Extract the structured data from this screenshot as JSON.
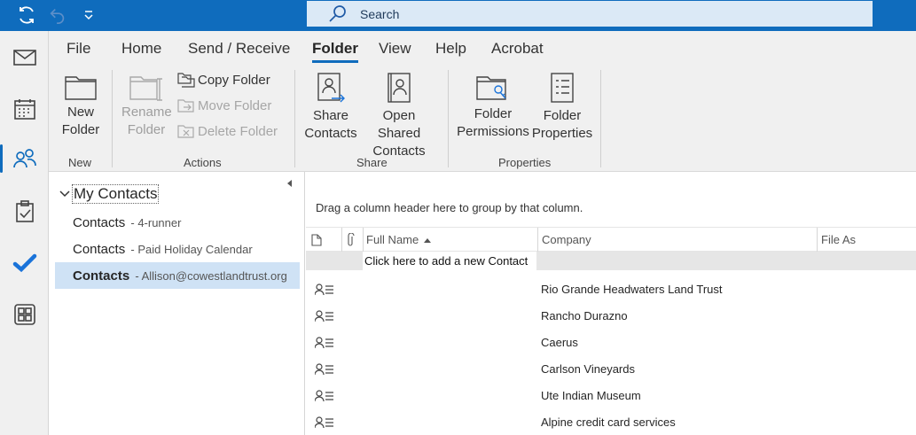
{
  "titlebar": {
    "search_placeholder": "Search",
    "icons": [
      "sync-icon",
      "undo-icon",
      "customize-quick-access-icon",
      "search-icon"
    ]
  },
  "rail": {
    "items": [
      {
        "name": "mail",
        "icon": "mail-icon"
      },
      {
        "name": "calendar",
        "icon": "calendar-icon"
      },
      {
        "name": "people",
        "icon": "people-icon",
        "active": true
      },
      {
        "name": "tasks",
        "icon": "tasks-icon"
      },
      {
        "name": "todo",
        "icon": "todo-check-icon"
      },
      {
        "name": "apps",
        "icon": "apps-icon"
      }
    ]
  },
  "ribbon": {
    "tabs": [
      "File",
      "Home",
      "Send / Receive",
      "Folder",
      "View",
      "Help",
      "Acrobat"
    ],
    "active_tab": "Folder",
    "groups": {
      "new": {
        "label": "New",
        "new_folder": [
          "New",
          "Folder"
        ]
      },
      "actions": {
        "label": "Actions",
        "rename_folder": [
          "Rename",
          "Folder"
        ],
        "copy_folder": "Copy Folder",
        "move_folder": "Move Folder",
        "delete_folder": "Delete Folder"
      },
      "share": {
        "label": "Share",
        "share_contacts": [
          "Share",
          "Contacts"
        ],
        "open_shared_contacts": [
          "Open Shared",
          "Contacts"
        ]
      },
      "properties": {
        "label": "Properties",
        "folder_permissions": [
          "Folder",
          "Permissions"
        ],
        "folder_properties": [
          "Folder",
          "Properties"
        ]
      }
    }
  },
  "folders": {
    "header": "My Contacts",
    "items": [
      {
        "main": "Contacts",
        "sub": "- 4-runner",
        "selected": false
      },
      {
        "main": "Contacts",
        "sub": "- Paid Holiday Calendar",
        "selected": false
      },
      {
        "main": "Contacts",
        "sub": "- Allison@cowestlandtrust.org",
        "selected": true
      }
    ]
  },
  "list": {
    "group_hint": "Drag a column header here to group by that column.",
    "columns": {
      "full_name": "Full Name",
      "company": "Company",
      "file_as": "File As"
    },
    "sort_column": "Full Name",
    "sort_direction": "ascending",
    "add_new": "Click here to add a new Contact",
    "rows": [
      {
        "company": "Rio Grande Headwaters Land Trust"
      },
      {
        "company": "Rancho Durazno"
      },
      {
        "company": "Caerus"
      },
      {
        "company": "Carlson Vineyards"
      },
      {
        "company": "Ute Indian Museum"
      },
      {
        "company": "Alpine credit card services"
      }
    ]
  },
  "colors": {
    "accent": "#0f6cbd",
    "search_bg": "#dbe9f6",
    "selected_folder_bg": "#cfe2f5"
  }
}
